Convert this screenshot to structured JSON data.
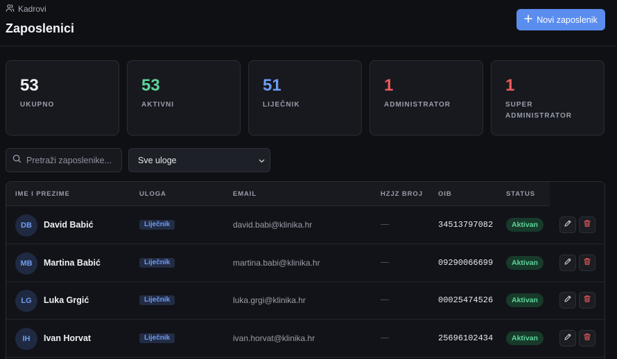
{
  "header": {
    "breadcrumb": "Kadrovi",
    "title": "Zaposlenici",
    "new_button_label": "Novi zaposlenik"
  },
  "stats": [
    {
      "value": "53",
      "label": "UKUPNO",
      "color": "#f4f5f8"
    },
    {
      "value": "53",
      "label": "AKTIVNI",
      "color": "#5fd39a"
    },
    {
      "value": "51",
      "label": "LIJEČNIK",
      "color": "#6f9cf2"
    },
    {
      "value": "1",
      "label": "ADMINISTRATOR",
      "color": "#ef5a5a"
    },
    {
      "value": "1",
      "label": "SUPER ADMINISTRATOR",
      "color": "#ef5a5a"
    }
  ],
  "filters": {
    "search_placeholder": "Pretraži zaposlenike...",
    "role_select_value": "Sve uloge"
  },
  "table": {
    "columns": [
      "IME I PREZIME",
      "ULOGA",
      "EMAIL",
      "HZJZ BROJ",
      "OIB",
      "STATUS"
    ],
    "rows": [
      {
        "initials": "DB",
        "name": "David Babić",
        "role": "Liječnik",
        "email": "david.babi@klinika.hr",
        "hzjz": "—",
        "oib": "34513797082",
        "status": "Aktivan"
      },
      {
        "initials": "MB",
        "name": "Martina Babić",
        "role": "Liječnik",
        "email": "martina.babi@klinika.hr",
        "hzjz": "—",
        "oib": "09290066699",
        "status": "Aktivan"
      },
      {
        "initials": "LG",
        "name": "Luka Grgić",
        "role": "Liječnik",
        "email": "luka.grgi@klinika.hr",
        "hzjz": "—",
        "oib": "00025474526",
        "status": "Aktivan"
      },
      {
        "initials": "IH",
        "name": "Ivan Horvat",
        "role": "Liječnik",
        "email": "ivan.horvat@klinika.hr",
        "hzjz": "—",
        "oib": "25696102434",
        "status": "Aktivan"
      }
    ]
  },
  "icons": {
    "breadcrumb": "users-icon",
    "new_button": "plus-icon",
    "search": "search-icon",
    "select": "chevron-down-icon",
    "edit": "pencil-icon",
    "delete": "trash-icon"
  },
  "colors": {
    "accent": "#5b8def",
    "background": "#0f1014",
    "danger": "#ef5a5a",
    "success": "#5fd39a"
  }
}
